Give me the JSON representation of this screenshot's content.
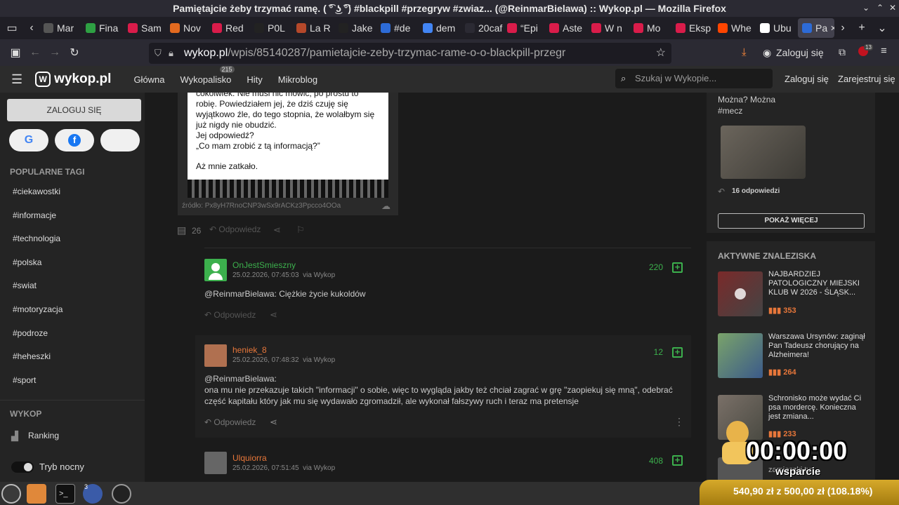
{
  "window": {
    "title": "Pamiętajcie żeby trzymać ramę. ( ͡° ͜ʖ ͡°) #blackpill #przegryw #zwiaz... (@ReinmarBielawa) :: Wykop.pl — Mozilla Firefox"
  },
  "tabs": [
    {
      "label": "Mar",
      "color": "#555555"
    },
    {
      "label": "Fina",
      "color": "#2ea043"
    },
    {
      "label": "Sam",
      "color": "#d91c4a"
    },
    {
      "label": "Nov",
      "color": "#e36a1f"
    },
    {
      "label": "Red",
      "color": "#d91c4a"
    },
    {
      "label": "P0L",
      "color": "#222222"
    },
    {
      "label": "La R",
      "color": "#b5482a"
    },
    {
      "label": "Jake",
      "color": "#222222"
    },
    {
      "label": "#de",
      "color": "#2d6bd6"
    },
    {
      "label": "dem",
      "color": "#4285f4"
    },
    {
      "label": "20caf2",
      "color": "#2b2a33"
    },
    {
      "label": "“Epi",
      "color": "#d91c4a"
    },
    {
      "label": "Aste",
      "color": "#d91c4a"
    },
    {
      "label": "W n",
      "color": "#d91c4a"
    },
    {
      "label": "Mo",
      "color": "#d91c4a"
    },
    {
      "label": "Eksp",
      "color": "#d91c4a"
    },
    {
      "label": "Whe",
      "color": "#ff4500"
    },
    {
      "label": "Ubu",
      "color": "#ffffff"
    },
    {
      "label": "Pa",
      "color": "#2d6bd6"
    }
  ],
  "browser": {
    "url_domain": "wykop.pl",
    "url_path": "/wpis/85140287/pamietajcie-zeby-trzymac-rame-o-o-blackpill-przegr",
    "login_label": "Zaloguj się",
    "ext_badge": "13"
  },
  "site": {
    "logo": "wykop.pl",
    "nav": [
      "Główna",
      "Wykopalisko",
      "Hity",
      "Mikroblog"
    ],
    "wykopalisko_badge": "215",
    "search_placeholder": "Szukaj w Wykopie...",
    "login": "Zaloguj się",
    "register": "Zarejestruj się"
  },
  "sidebar": {
    "login_button": "ZALOGUJ SIĘ",
    "popular_tags_title": "POPULARNE TAGI",
    "tags": [
      "#ciekawostki",
      "#informacje",
      "#technologia",
      "#polska",
      "#swiat",
      "#motoryzacja",
      "#podroze",
      "#heheszki",
      "#sport"
    ],
    "wykop_title": "WYKOP",
    "ranking": "Ranking",
    "night_mode": "Tryb nocny"
  },
  "post": {
    "image_text": {
      "l1": "cokolwiek. Nie musi nic mówić, po prostu to",
      "l2": "robię. Powiedziałem jej, że dziś czuję się",
      "l3": "wyjątkowo źle, do tego stopnia, że wolałbym się",
      "l4": "już nigdy nie obudzić.",
      "l5": "Jej odpowiedź?",
      "l6": "„Co mam zrobić z tą informacją?”",
      "l7": "Aż mnie zatkało."
    },
    "source": "źródło: Px8yH7RnoCNP3wSx9rACKz3Ppcco4OOa",
    "comment_count": "26",
    "reply_label": "Odpowiedz"
  },
  "comments": [
    {
      "user": "OnJestSmieszny",
      "user_color": "#3cb04d",
      "date": "25.02.2026, 07:45:03",
      "via": "via Wykop",
      "score": "220",
      "text": "@ReinmarBielawa: Ciężkie życie kukoldów",
      "reply": "Odpowiedz"
    },
    {
      "user": "heniek_8",
      "user_color": "#e8773a",
      "date": "25.02.2026, 07:48:32",
      "via": "via Wykop",
      "score": "12",
      "text1": "@ReinmarBielawa:",
      "text2": "ona mu nie przekazuje takich \"informacji\" o sobie, więc to wygląda jakby też chciał zagrać w grę \"zaopiekuj się mną\", odebrać",
      "text3": "część kapitału który jak mu się wydawało zgromadził, ale wykonał fałszywy ruch i teraz ma pretensje",
      "reply": "Odpowiedz"
    },
    {
      "user": "Ulquiorra",
      "user_color": "#e8773a",
      "date": "25.02.2026, 07:51:45",
      "via": "via Wykop",
      "score": "408"
    }
  ],
  "right": {
    "top_text": "Można? Można",
    "top_tag": "#mecz",
    "replies": "16 odpowiedzi",
    "show_more": "POKAŻ WIĘCEJ",
    "active_title": "AKTYWNE ZNALEZISKA",
    "findings": [
      {
        "title": "NAJBARDZIEJ PATOLOGICZNY MIEJSKI KLUB W 2026 - ŚLĄSK...",
        "count": "353"
      },
      {
        "title": "Warszawa Ursynów: zaginął Pan Tadeusz chorujący na Alzheimera!",
        "count": "264"
      },
      {
        "title": "Schronisko może wydać Ci psa mordercę. Konieczna jest zmiana...",
        "count": "233"
      }
    ],
    "partial_text": "zamieszki tuż..."
  },
  "overlay": {
    "timer": "00:00:00",
    "wsparcie": "wsparcie",
    "donate": "540,90 zł z 500,00 zł (108.18%)"
  },
  "taskbar": {
    "firefox_badge": "3"
  }
}
